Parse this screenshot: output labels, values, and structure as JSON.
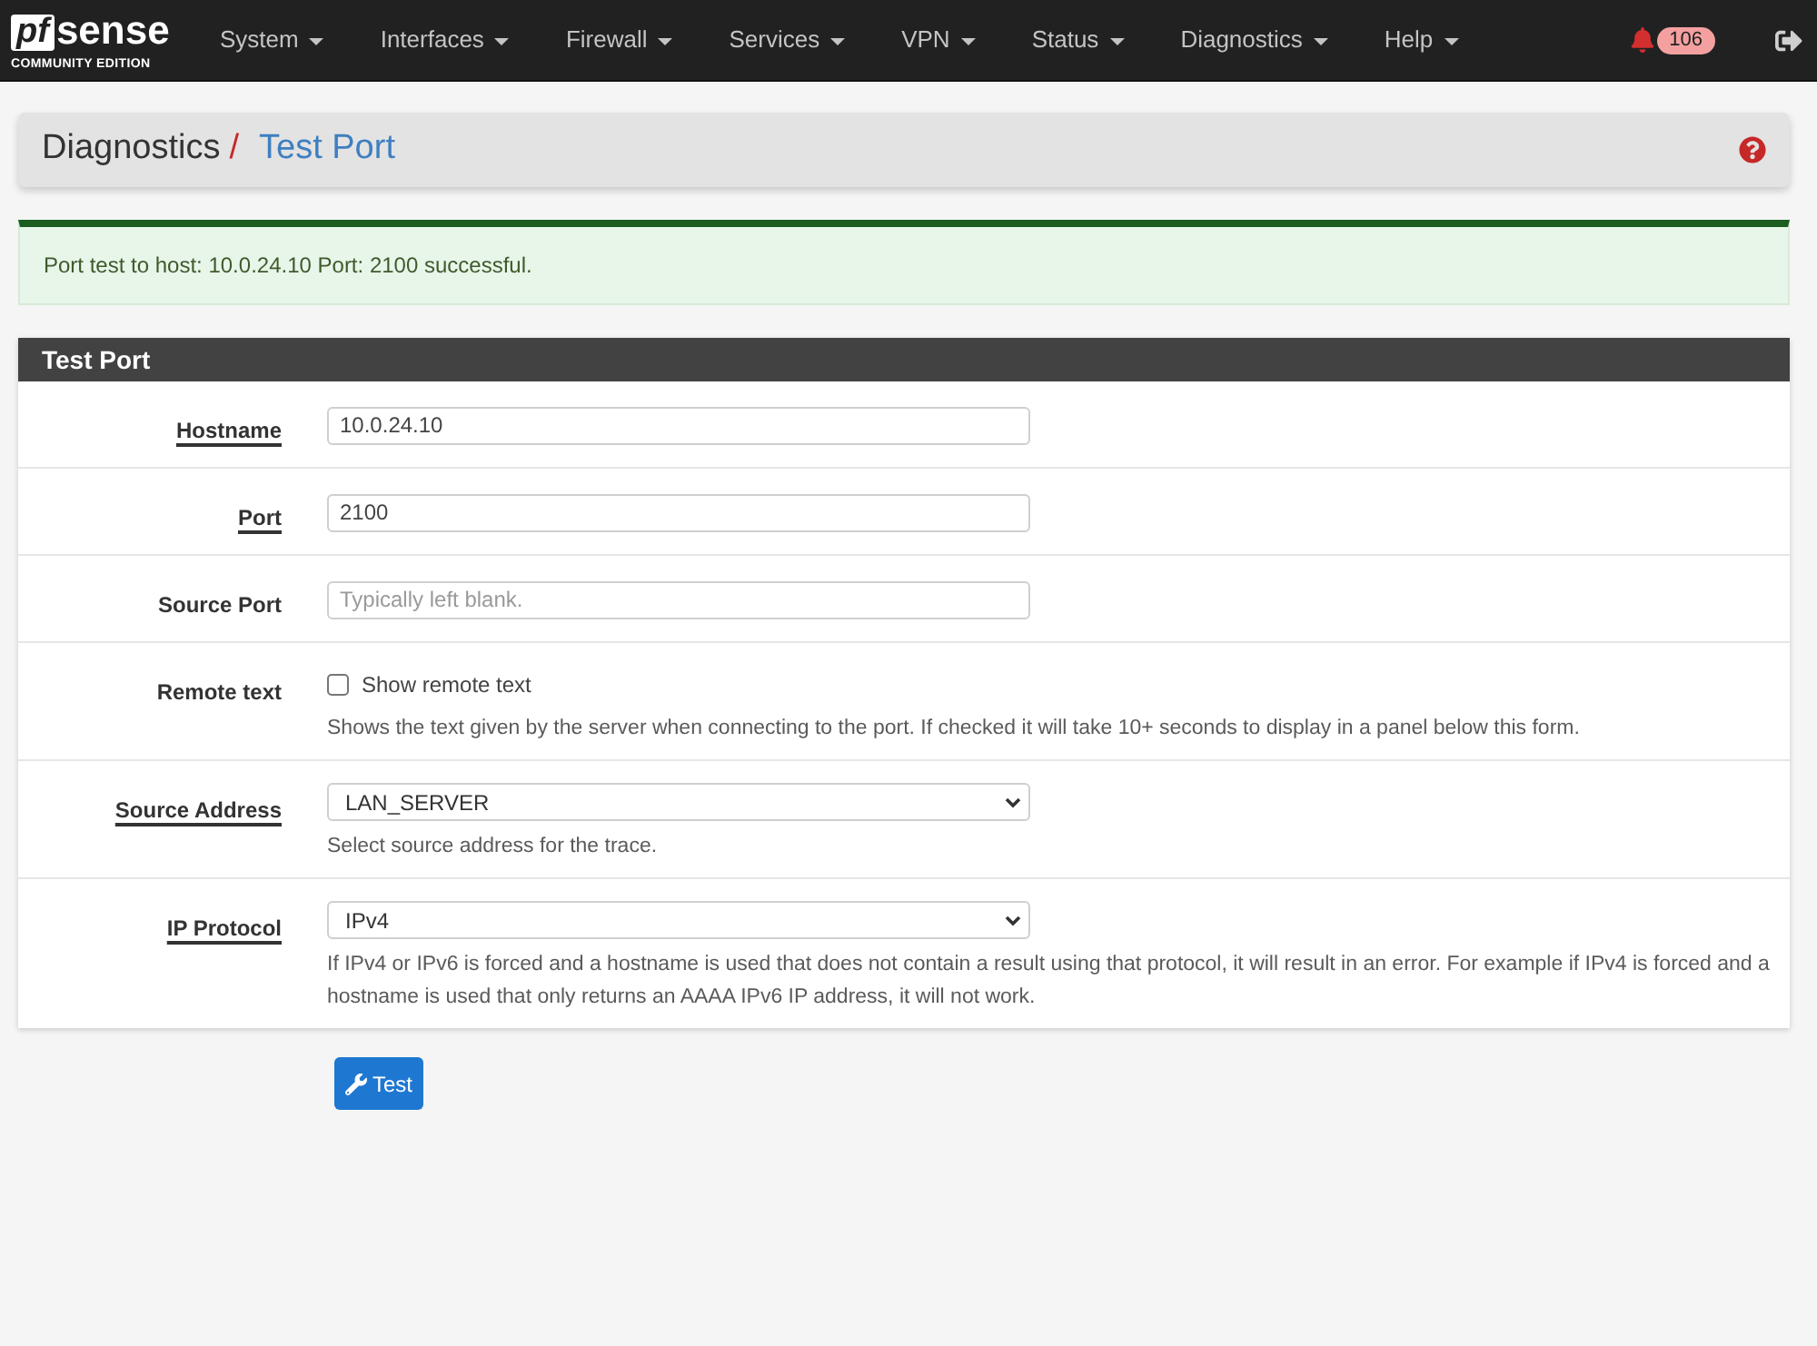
{
  "navbar": {
    "logo": {
      "mark": "pf",
      "wordmark": "sense",
      "tagline": "COMMUNITY EDITION"
    },
    "menu": [
      {
        "label": "System"
      },
      {
        "label": "Interfaces"
      },
      {
        "label": "Firewall"
      },
      {
        "label": "Services"
      },
      {
        "label": "VPN"
      },
      {
        "label": "Status"
      },
      {
        "label": "Diagnostics"
      },
      {
        "label": "Help"
      }
    ],
    "notifications": {
      "count": "106"
    }
  },
  "breadcrumb": {
    "parent": "Diagnostics",
    "separator": "/",
    "current": "Test Port"
  },
  "alert": {
    "kind": "success",
    "message": "Port test to host: 10.0.24.10 Port: 2100 successful."
  },
  "panel": {
    "title": "Test Port",
    "fields": [
      {
        "kind": "text",
        "label": "Hostname",
        "required": true,
        "value": "10.0.24.10"
      },
      {
        "kind": "text",
        "label": "Port",
        "required": true,
        "value": "2100"
      },
      {
        "kind": "text",
        "label": "Source Port",
        "required": false,
        "placeholder": "Typically left blank."
      },
      {
        "kind": "checkbox",
        "label": "Remote text",
        "required": false,
        "option": "Show remote text",
        "checked": false,
        "help": "Shows the text given by the server when connecting to the port. If checked it will take 10+ seconds to display in a panel below this form."
      },
      {
        "kind": "select",
        "label": "Source Address",
        "required": true,
        "value": "LAN_SERVER",
        "help": "Select source address for the trace."
      },
      {
        "kind": "select",
        "label": "IP Protocol",
        "required": true,
        "value": "IPv4",
        "help": "If IPv4 or IPv6 is forced and a hostname is used that does not contain a result using that protocol, it will result in an error. For example if IPv4 is forced and a hostname is used that only returns an AAAA IPv6 IP address, it will not work."
      }
    ]
  },
  "submit": {
    "label": "Test"
  }
}
